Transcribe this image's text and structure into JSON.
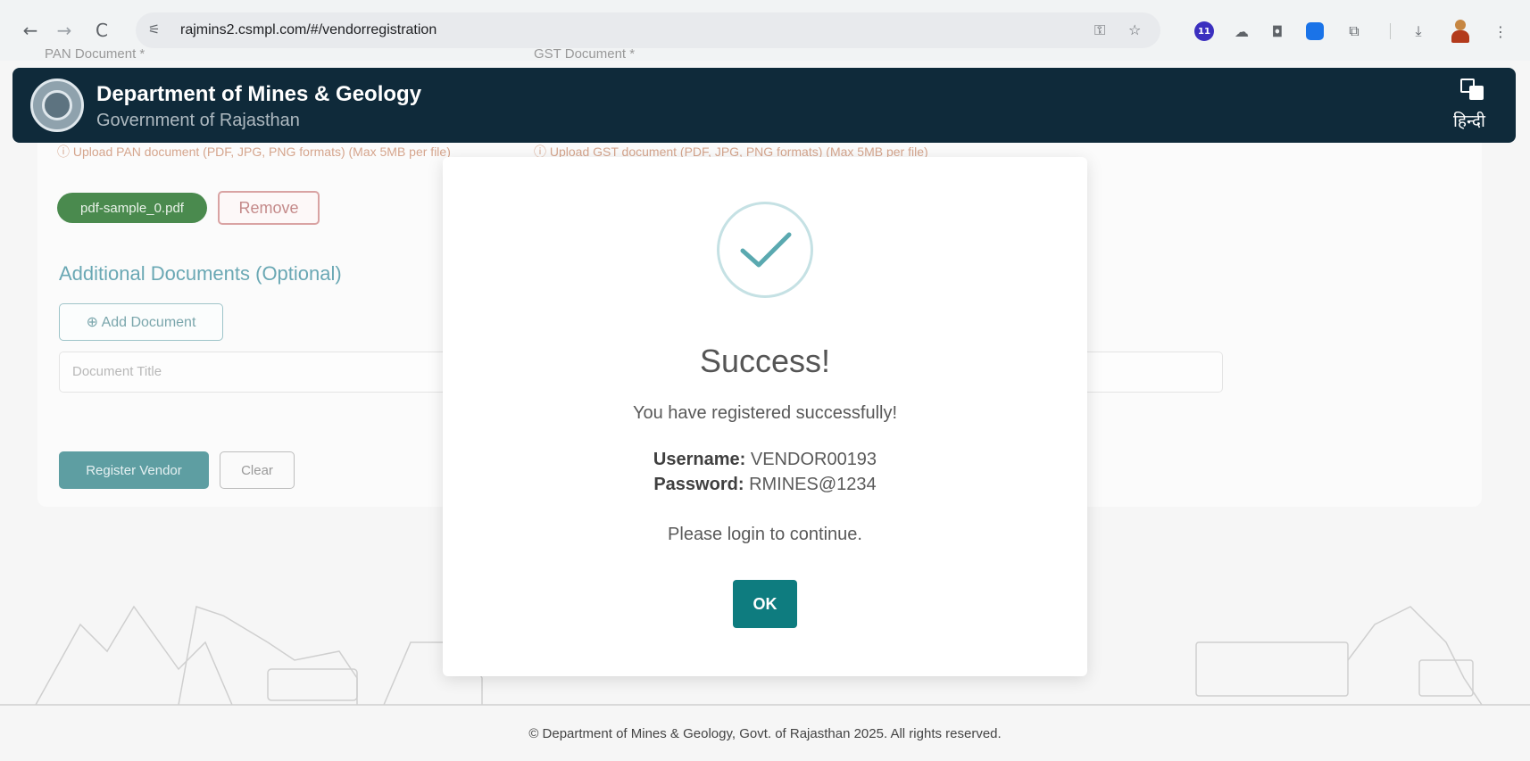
{
  "browser": {
    "back_glyph": "←",
    "forward_glyph": "→",
    "reload_glyph": "C",
    "site_info_glyph": "⚟",
    "url": "rajmins2.csmpl.com/#/vendorregistration",
    "key_glyph": "⚿",
    "star_glyph": "☆",
    "ext_badge_text": "11",
    "download_glyph": "⤓",
    "menu_glyph": "⋮"
  },
  "header": {
    "title": "Department of Mines & Geology",
    "subtitle": "Government of Rajasthan",
    "language_label": "हिन्दी"
  },
  "form": {
    "pan_label": "PAN Document *",
    "gst_label": "GST Document *",
    "pan_hint": "ⓘ Upload PAN document (PDF, JPG, PNG formats) (Max 5MB per file)",
    "gst_hint": "ⓘ Upload GST document (PDF, JPG, PNG formats) (Max 5MB per file)",
    "uploaded_file": "pdf-sample_0.pdf",
    "remove_label": "Remove",
    "additional_title": "Additional Documents (Optional)",
    "add_document_label": "⊕ Add Document",
    "document_title_placeholder": "Document Title",
    "register_label": "Register Vendor",
    "clear_label": "Clear"
  },
  "modal": {
    "title": "Success!",
    "message": "You have registered successfully!",
    "username_label": "Username:",
    "username_value": "VENDOR00193",
    "password_label": "Password:",
    "password_value": "RMINES@1234",
    "login_message": "Please login to continue.",
    "ok_label": "OK"
  },
  "footer": {
    "text": "© Department of Mines & Geology, Govt. of Rajasthan 2025. All rights reserved."
  },
  "colors": {
    "header_bg": "#0f2a3a",
    "accent_teal": "#0e7c7f",
    "success_check": "#5aa9b0"
  }
}
